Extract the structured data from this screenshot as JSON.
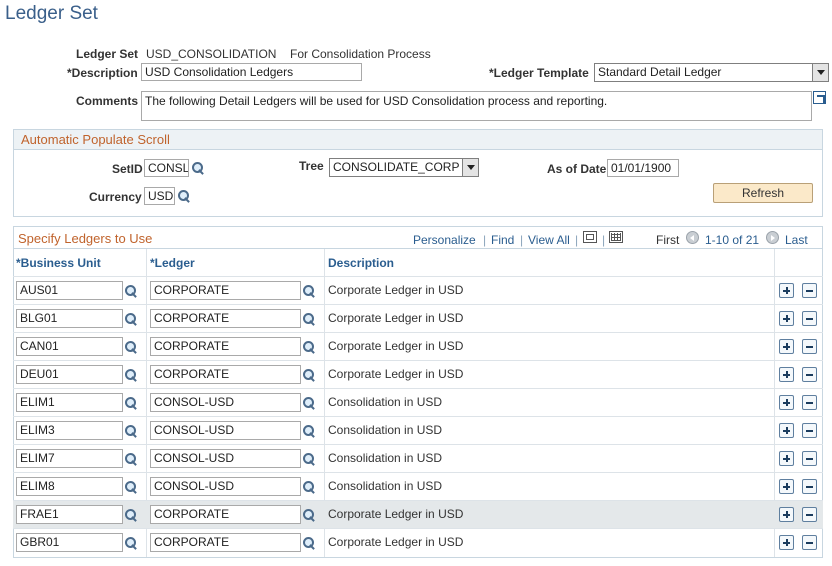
{
  "page": {
    "title": "Ledger Set"
  },
  "header": {
    "ledger_set_label": "Ledger Set",
    "ledger_set_value": "USD_CONSOLIDATION",
    "ledger_set_desc": "For Consolidation Process",
    "description_label": "*Description",
    "description_value": "USD Consolidation Ledgers",
    "ledger_template_label": "*Ledger Template",
    "ledger_template_value": "Standard Detail Ledger",
    "comments_label": "Comments",
    "comments_value": "The following Detail Ledgers will be used for USD Consolidation process and reporting."
  },
  "auto_populate": {
    "title": "Automatic Populate Scroll",
    "setid_label": "SetID",
    "setid_value": "CONSL",
    "tree_label": "Tree",
    "tree_value": "CONSOLIDATE_CORP",
    "as_of_date_label": "As of Date",
    "as_of_date_value": "01/01/1900",
    "currency_label": "Currency",
    "currency_value": "USD",
    "refresh_label": "Refresh"
  },
  "grid": {
    "title": "Specify Ledgers to Use",
    "personalize": "Personalize",
    "find": "Find",
    "view_all": "View All",
    "first": "First",
    "range": "1-10 of 21",
    "last": "Last",
    "columns": {
      "business_unit": "*Business Unit",
      "ledger": "*Ledger",
      "description": "Description"
    },
    "rows": [
      {
        "business_unit": "AUS01",
        "ledger": "CORPORATE",
        "description": "Corporate Ledger in USD"
      },
      {
        "business_unit": "BLG01",
        "ledger": "CORPORATE",
        "description": "Corporate Ledger in USD"
      },
      {
        "business_unit": "CAN01",
        "ledger": "CORPORATE",
        "description": "Corporate Ledger in USD"
      },
      {
        "business_unit": "DEU01",
        "ledger": "CORPORATE",
        "description": "Corporate Ledger in USD"
      },
      {
        "business_unit": "ELIM1",
        "ledger": "CONSOL-USD",
        "description": "Consolidation in USD"
      },
      {
        "business_unit": "ELIM3",
        "ledger": "CONSOL-USD",
        "description": "Consolidation in USD"
      },
      {
        "business_unit": "ELIM7",
        "ledger": "CONSOL-USD",
        "description": "Consolidation in USD"
      },
      {
        "business_unit": "ELIM8",
        "ledger": "CONSOL-USD",
        "description": "Consolidation in USD"
      },
      {
        "business_unit": "FRAE1",
        "ledger": "CORPORATE",
        "description": "Corporate Ledger in USD"
      },
      {
        "business_unit": "GBR01",
        "ledger": "CORPORATE",
        "description": "Corporate Ledger in USD"
      }
    ]
  }
}
